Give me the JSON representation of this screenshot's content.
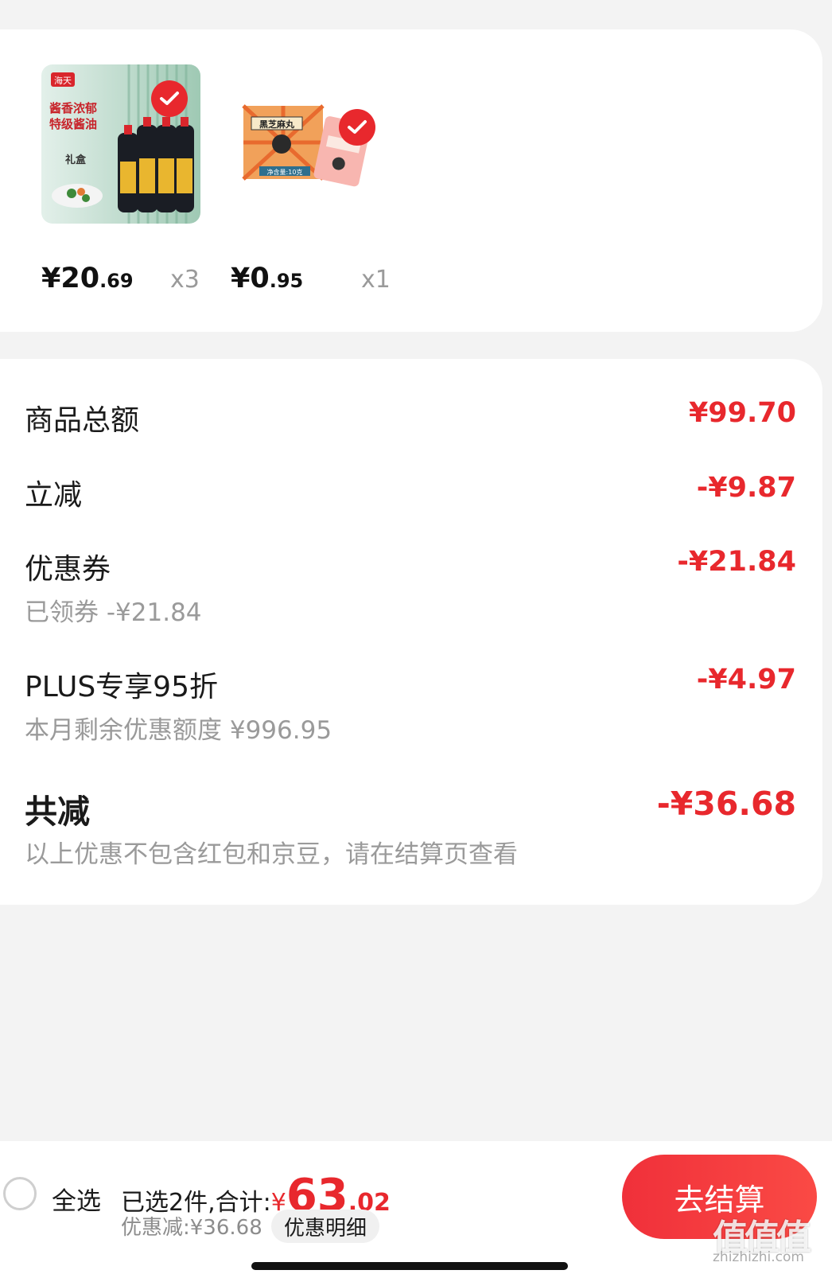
{
  "products": [
    {
      "name": "酱香浓郁特级酱油",
      "price_int": "¥20",
      "price_dec": ".69",
      "qty": "x3",
      "image_texts": {
        "brand": "海天",
        "line1": "酱香浓郁",
        "line2": "特级酱油",
        "tag": "礼盒"
      }
    },
    {
      "name": "黑芝麻丸",
      "price_int": "¥0",
      "price_dec": ".95",
      "qty": "x1",
      "image_texts": {
        "label": "黑芝麻丸",
        "net": "净含量:10克"
      }
    }
  ],
  "summary": {
    "goods_total_label": "商品总额",
    "goods_total_value": "¥99.70",
    "instant_label": "立减",
    "instant_value": "-¥9.87",
    "coupon_label": "优惠券",
    "coupon_value": "-¥21.84",
    "coupon_sub": "已领券 -¥21.84",
    "plus_label": "PLUS专享95折",
    "plus_value": "-¥4.97",
    "plus_sub": "本月剩余优惠额度 ¥996.95",
    "grand_label": "共减",
    "grand_value": "-¥36.68",
    "grand_sub": "以上优惠不包含红包和京豆，请在结算页查看"
  },
  "bottom_bar": {
    "select_all": "全选",
    "selected_prefix": "已选2件,合计:",
    "yen": "¥",
    "total_int": "63",
    "total_dec": ".02",
    "discount_line": "优惠减:¥36.68",
    "detail_button": "优惠明细",
    "checkout_button": "去结算"
  },
  "watermark": {
    "text": "值值值",
    "url": "zhizhizhi.com"
  },
  "colors": {
    "accent": "#e8282d",
    "background": "#f3f3f3"
  }
}
